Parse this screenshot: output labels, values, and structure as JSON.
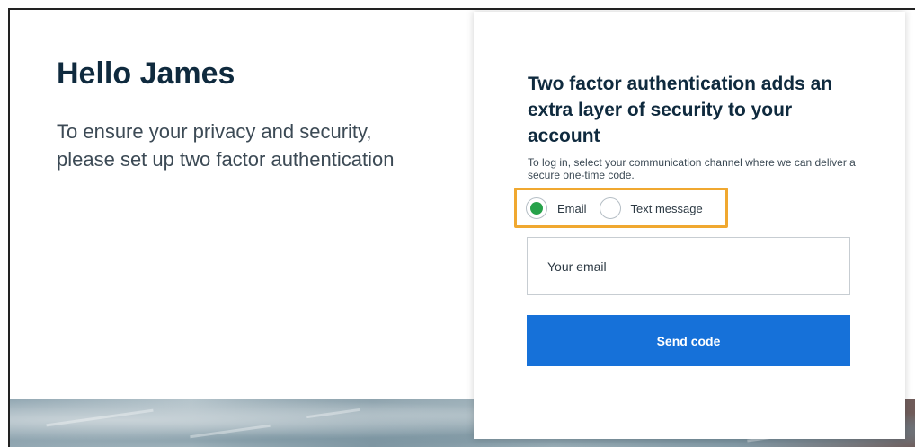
{
  "left_panel": {
    "greeting": "Hello James",
    "intro": "To ensure your privacy and security, please set up two factor authentication"
  },
  "card": {
    "title": "Two factor authentication adds an extra layer of security to your account",
    "description": "To log in, select your communication channel where we can deliver a secure one-time code.",
    "channel_options": [
      {
        "label": "Email",
        "selected": true
      },
      {
        "label": "Text message",
        "selected": false
      }
    ],
    "email_field": {
      "placeholder": "Your email",
      "value": ""
    },
    "send_button_label": "Send code"
  },
  "colors": {
    "heading": "#0f2a3e",
    "body_text": "#3c4a55",
    "accent_button": "#1671d9",
    "radio_selected": "#27a24a",
    "highlight_outline": "#f0a830"
  }
}
